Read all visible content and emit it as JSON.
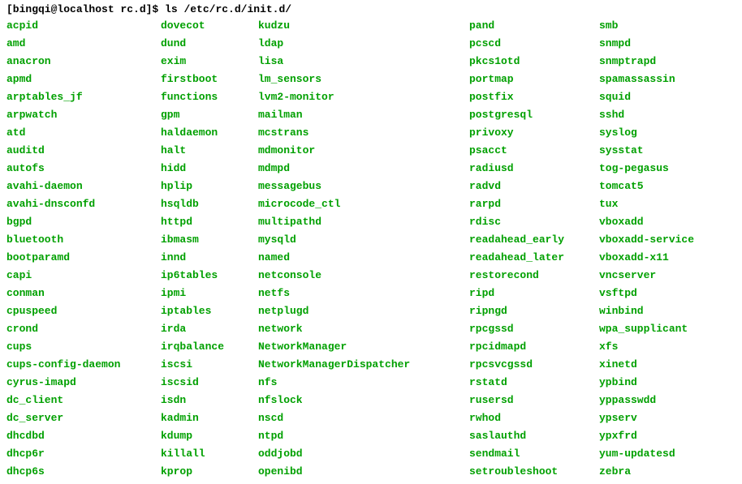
{
  "prompt": "[bingqi@localhost rc.d]$ ",
  "command": "ls /etc/rc.d/init.d/",
  "columns": [
    [
      "acpid",
      "amd",
      "anacron",
      "apmd",
      "arptables_jf",
      "arpwatch",
      "atd",
      "auditd",
      "autofs",
      "avahi-daemon",
      "avahi-dnsconfd",
      "bgpd",
      "bluetooth",
      "bootparamd",
      "capi",
      "conman",
      "cpuspeed",
      "crond",
      "cups",
      "cups-config-daemon",
      "cyrus-imapd",
      "dc_client",
      "dc_server",
      "dhcdbd",
      "dhcp6r",
      "dhcp6s"
    ],
    [
      "dovecot",
      "dund",
      "exim",
      "firstboot",
      "functions",
      "gpm",
      "haldaemon",
      "halt",
      "hidd",
      "hplip",
      "hsqldb",
      "httpd",
      "ibmasm",
      "innd",
      "ip6tables",
      "ipmi",
      "iptables",
      "irda",
      "irqbalance",
      "iscsi",
      "iscsid",
      "isdn",
      "kadmin",
      "kdump",
      "killall",
      "kprop"
    ],
    [
      "kudzu",
      "ldap",
      "lisa",
      "lm_sensors",
      "lvm2-monitor",
      "mailman",
      "mcstrans",
      "mdmonitor",
      "mdmpd",
      "messagebus",
      "microcode_ctl",
      "multipathd",
      "mysqld",
      "named",
      "netconsole",
      "netfs",
      "netplugd",
      "network",
      "NetworkManager",
      "NetworkManagerDispatcher",
      "nfs",
      "nfslock",
      "nscd",
      "ntpd",
      "oddjobd",
      "openibd"
    ],
    [
      "pand",
      "pcscd",
      "pkcs1otd",
      "portmap",
      "postfix",
      "postgresql",
      "privoxy",
      "psacct",
      "radiusd",
      "radvd",
      "rarpd",
      "rdisc",
      "readahead_early",
      "readahead_later",
      "restorecond",
      "ripd",
      "ripngd",
      "rpcgssd",
      "rpcidmapd",
      "rpcsvcgssd",
      "rstatd",
      "rusersd",
      "rwhod",
      "saslauthd",
      "sendmail",
      "setroubleshoot"
    ],
    [
      "smb",
      "snmpd",
      "snmptrapd",
      "spamassassin",
      "squid",
      "sshd",
      "syslog",
      "sysstat",
      "tog-pegasus",
      "tomcat5",
      "tux",
      "vboxadd",
      "vboxadd-service",
      "vboxadd-x11",
      "vncserver",
      "vsftpd",
      "winbind",
      "wpa_supplicant",
      "xfs",
      "xinetd",
      "ypbind",
      "yppasswdd",
      "ypserv",
      "ypxfrd",
      "yum-updatesd",
      "zebra"
    ]
  ]
}
